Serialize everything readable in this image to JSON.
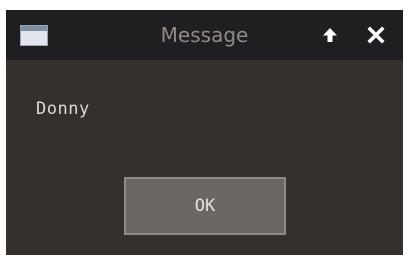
{
  "window": {
    "title": "Message"
  },
  "titlebar": {
    "app_icon": "window-icon",
    "buttons": [
      {
        "name": "maximize",
        "icon": "arrow-up-icon"
      },
      {
        "name": "close",
        "icon": "close-icon"
      }
    ]
  },
  "dialog": {
    "message": "Donny",
    "ok_label": "OK"
  },
  "colors": {
    "titlebar_bg": "#1f1e20",
    "body_bg": "#33302e",
    "button_bg": "#6b6764",
    "button_border": "#8e8a87",
    "title_text": "#8f8b88",
    "text": "#dedad6"
  }
}
